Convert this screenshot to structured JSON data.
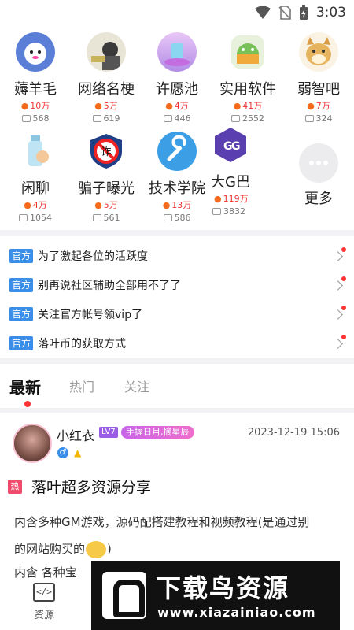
{
  "status_bar": {
    "time": "3:03",
    "icons": [
      "wifi-icon",
      "no-sim-icon",
      "battery-charging-icon"
    ]
  },
  "categories": [
    {
      "name": "薅羊毛",
      "heat": "10万",
      "comments": "568",
      "icon": "sheep-avatar"
    },
    {
      "name": "网络名梗",
      "heat": "5万",
      "comments": "619",
      "icon": "meme-avatar"
    },
    {
      "name": "许愿池",
      "heat": "4万",
      "comments": "446",
      "icon": "wishing-pool-avatar"
    },
    {
      "name": "实用软件",
      "heat": "41万",
      "comments": "2552",
      "icon": "android-avatar"
    },
    {
      "name": "弱智吧",
      "heat": "7万",
      "comments": "324",
      "icon": "doge-avatar"
    },
    {
      "name": "闲聊",
      "heat": "4万",
      "comments": "1054",
      "icon": "bottle-avatar"
    },
    {
      "name": "骗子曝光",
      "heat": "5万",
      "comments": "561",
      "icon": "fraud-sign-avatar"
    },
    {
      "name": "技术学院",
      "heat": "13万",
      "comments": "586",
      "icon": "wrench-avatar"
    },
    {
      "name": "大G巴",
      "heat": "119万",
      "comments": "3832",
      "icon": "gg-avatar"
    }
  ],
  "more_label": "更多",
  "notices": [
    {
      "tag": "官方",
      "text": "为了激起各位的活跃度"
    },
    {
      "tag": "官方",
      "text": "别再说社区辅助全部用不了了"
    },
    {
      "tag": "官方",
      "text": "关注官方帐号领vip了"
    },
    {
      "tag": "官方",
      "text": "落叶币的获取方式"
    }
  ],
  "tabs": [
    "最新",
    "热门",
    "关注"
  ],
  "post": {
    "username": "小红衣",
    "level": "LV7",
    "title_badge": "手握日月,摘星辰",
    "gender": "♂",
    "time": "2023-12-19 15:06",
    "hot_tag": "热",
    "title": "落叶超多资源分享",
    "body_line1": "内含多种GM游戏，源码配搭建教程和视频教程(是通过别",
    "body_line2a": "的网站购买的",
    "body_line2b": ")",
    "body_line3": "内含   各种宝"
  },
  "bottom_nav": {
    "label": "资源",
    "icon_text": "</>"
  },
  "watermark": {
    "main": "下载鸟资源",
    "url": "www.xiazainiao.com"
  },
  "colors": {
    "accent_blue": "#3a8ee8",
    "heat_red": "#e33",
    "notice_dot": "#f33",
    "badge_purple": "#9b5de5"
  }
}
